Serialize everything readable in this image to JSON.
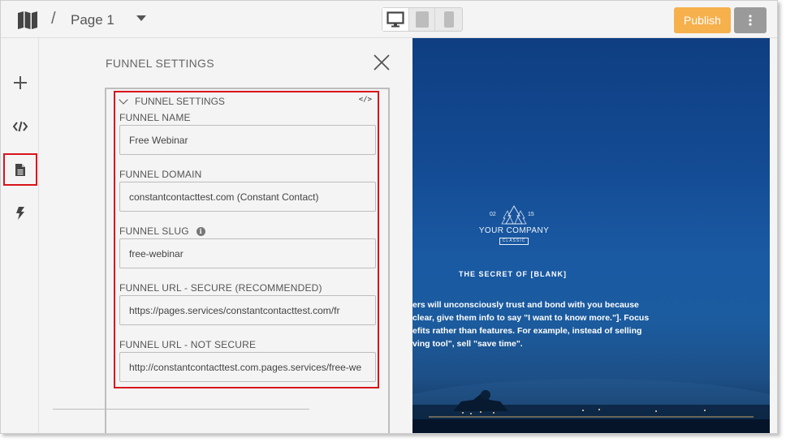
{
  "header": {
    "slash": "/",
    "page_name": "Page 1",
    "publish_label": "Publish"
  },
  "panel": {
    "title": "FUNNEL SETTINGS",
    "section_title": "FUNNEL SETTINGS",
    "code_icon_text": "</>",
    "fields": [
      {
        "label": "FUNNEL NAME",
        "value": "Free Webinar"
      },
      {
        "label": "FUNNEL DOMAIN",
        "value": "constantcontacttest.com (Constant Contact)"
      },
      {
        "label": "FUNNEL SLUG",
        "value": "free-webinar",
        "info_icon": "i"
      },
      {
        "label": "FUNNEL URL - SECURE (RECOMMENDED)",
        "value": "https://pages.services/constantcontacttest.com/fr"
      },
      {
        "label": "FUNNEL URL - NOT SECURE",
        "value": "http://constantcontacttest.com.pages.services/free-we"
      }
    ]
  },
  "preview": {
    "logo_left_number": "02",
    "logo_right_number": "15",
    "company": "YOUR COMPANY",
    "classic": "CLASSIC",
    "headline": "THE SECRET OF [BLANK]",
    "body_lines": [
      "ers will unconsciously trust and bond with you because",
      "clear, give them info to say \"I want to know more.\"]. Focus",
      "efits rather than features. For example, instead of selling",
      "ving tool\", sell \"save time\"."
    ]
  },
  "colors": {
    "publish": "#f6b04c",
    "highlight": "#d9141b",
    "preview_sky": "#134a92"
  }
}
